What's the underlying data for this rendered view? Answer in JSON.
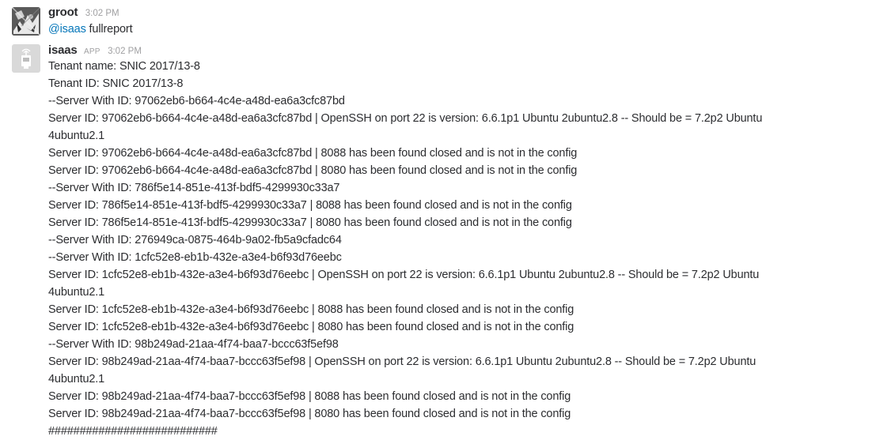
{
  "messages": [
    {
      "username": "groot",
      "timestamp": "3:02 PM",
      "mention": "@isaas",
      "text": " fullreport"
    },
    {
      "username": "isaas",
      "badge": "APP",
      "timestamp": "3:02 PM",
      "lines": [
        "Tenant name: SNIC 2017/13-8",
        "Tenant ID: SNIC 2017/13-8",
        "--Server With ID: 97062eb6-b664-4c4e-a48d-ea6a3cfc87bd",
        "Server ID: 97062eb6-b664-4c4e-a48d-ea6a3cfc87bd |  OpenSSH on port 22 is version: 6.6.1p1 Ubuntu 2ubuntu2.8 -- Should be = 7.2p2 Ubuntu 4ubuntu2.1",
        "Server ID: 97062eb6-b664-4c4e-a48d-ea6a3cfc87bd | 8088 has been found closed and is not in the config",
        "Server ID: 97062eb6-b664-4c4e-a48d-ea6a3cfc87bd | 8080 has been found closed and is not in the config",
        "--Server With ID: 786f5e14-851e-413f-bdf5-4299930c33a7",
        "Server ID: 786f5e14-851e-413f-bdf5-4299930c33a7 | 8088 has been found closed and is not in the config",
        "Server ID: 786f5e14-851e-413f-bdf5-4299930c33a7 | 8080 has been found closed and is not in the config",
        "--Server With ID: 276949ca-0875-464b-9a02-fb5a9cfadc64",
        "--Server With ID: 1cfc52e8-eb1b-432e-a3e4-b6f93d76eebc",
        "Server ID: 1cfc52e8-eb1b-432e-a3e4-b6f93d76eebc |  OpenSSH on port 22 is version: 6.6.1p1 Ubuntu 2ubuntu2.8 -- Should be = 7.2p2 Ubuntu 4ubuntu2.1",
        "Server ID: 1cfc52e8-eb1b-432e-a3e4-b6f93d76eebc | 8088 has been found closed and is not in the config",
        "Server ID: 1cfc52e8-eb1b-432e-a3e4-b6f93d76eebc | 8080 has been found closed and is not in the config",
        "--Server With ID: 98b249ad-21aa-4f74-baa7-bccc63f5ef98",
        "Server ID: 98b249ad-21aa-4f74-baa7-bccc63f5ef98 |  OpenSSH on port 22 is version: 6.6.1p1 Ubuntu 2ubuntu2.8 -- Should be = 7.2p2 Ubuntu 4ubuntu2.1",
        "Server ID: 98b249ad-21aa-4f74-baa7-bccc63f5ef98 | 8088 has been found closed and is not in the config",
        "Server ID: 98b249ad-21aa-4f74-baa7-bccc63f5ef98 | 8080 has been found closed and is not in the config",
        "###########################"
      ]
    }
  ]
}
